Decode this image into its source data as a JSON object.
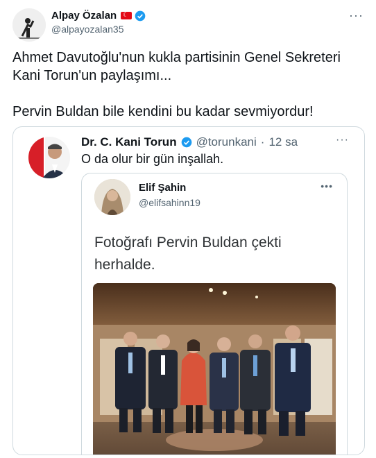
{
  "author": {
    "name": "Alpay Özalan",
    "handle": "@alpayozalan35",
    "text": "Ahmet Davutoğlu'nun kukla partisinin Genel Sekreteri\nKani Torun'un paylaşımı...\n\nPervin Buldan bile kendini bu kadar sevmiyordur!",
    "more_icon": "more-icon"
  },
  "quoted": {
    "name": "Dr. C. Kani Torun",
    "handle": "@torunkani",
    "separator": "·",
    "time": "12 sa",
    "text": "O da olur bir gün inşallah."
  },
  "inner": {
    "name": "Elif Şahin",
    "handle": "@elifsahinn19",
    "text": "Fotoğrafı Pervin Buldan çekti\nherhalde."
  },
  "colors": {
    "accent": "#1d9bf0",
    "text": "#0f1419",
    "secondary": "#536471",
    "border": "#cfd9de",
    "flag": "#e30a17"
  }
}
